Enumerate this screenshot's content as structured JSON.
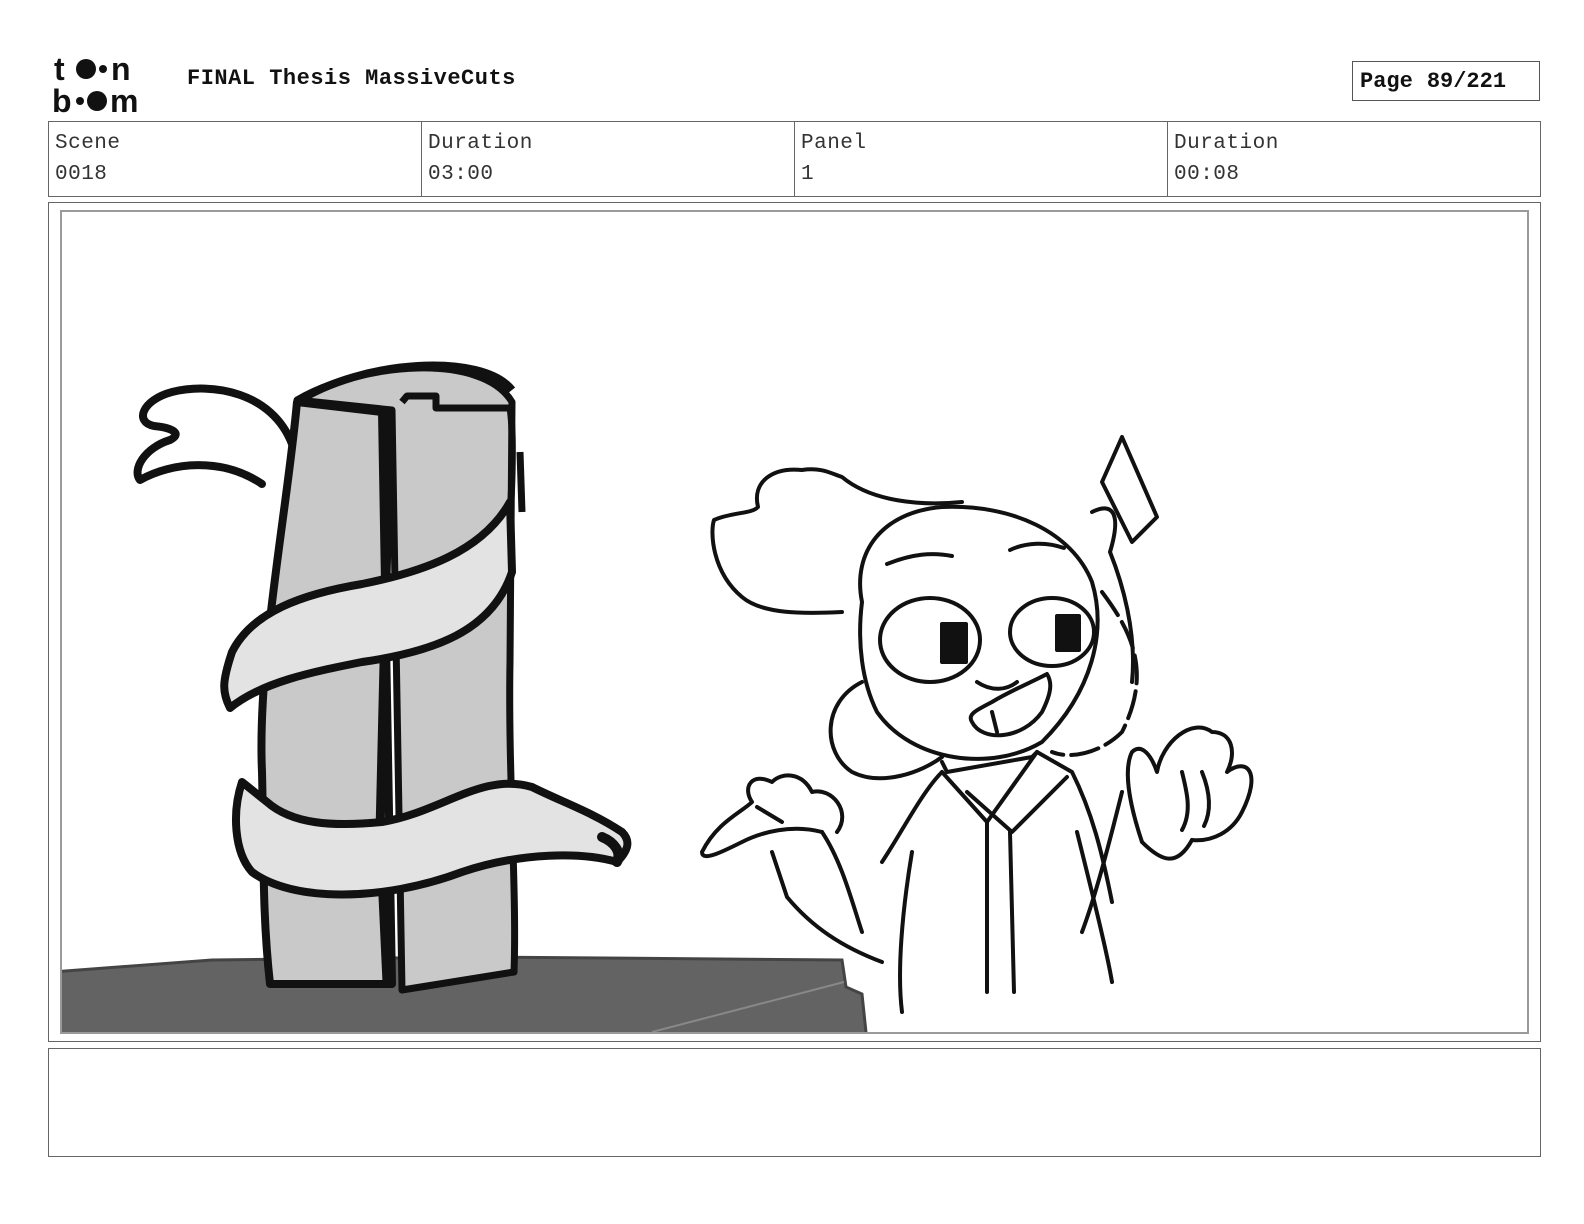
{
  "header": {
    "logo_alt": "toon boom",
    "project_title": "FINAL Thesis MassiveCuts",
    "page_label": "Page",
    "page_value": "89/221"
  },
  "info": {
    "scene_label": "Scene",
    "scene_value": "0018",
    "scene_duration_label": "Duration",
    "scene_duration_value": "03:00",
    "panel_label": "Panel",
    "panel_value": "1",
    "panel_duration_label": "Duration",
    "panel_duration_value": "00:08"
  },
  "notes": {
    "text": ""
  },
  "icons": {
    "logo": "toonboom-logo-icon"
  }
}
